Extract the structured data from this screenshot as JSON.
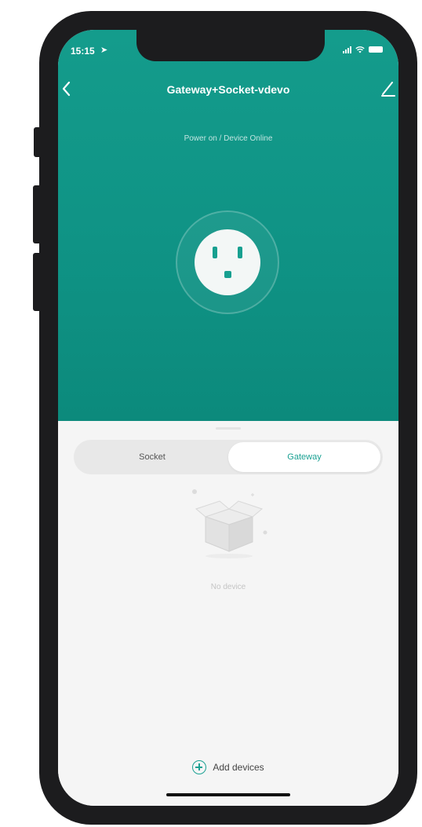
{
  "status_bar": {
    "time": "15:15",
    "location_arrow": "location-arrow-icon",
    "signal": "signal-icon",
    "wifi": "wifi-icon",
    "battery": "battery-icon"
  },
  "nav": {
    "back_icon": "chevron-left-icon",
    "title": "Gateway+Socket-vdevo",
    "edit_icon": "pencil-icon"
  },
  "hero": {
    "status_text": "Power on / Device Online",
    "outlet_icon": "power-outlet-icon"
  },
  "tabs": {
    "items": [
      {
        "label": "Socket",
        "active": false
      },
      {
        "label": "Gateway",
        "active": true
      }
    ]
  },
  "empty_state": {
    "illustration": "empty-box-icon",
    "message": "No device"
  },
  "footer": {
    "add_label": "Add devices",
    "add_icon": "plus-circle-icon"
  },
  "colors": {
    "primary": "#149c8c",
    "accent_text": "#1ba193",
    "background": "#f5f5f5"
  }
}
